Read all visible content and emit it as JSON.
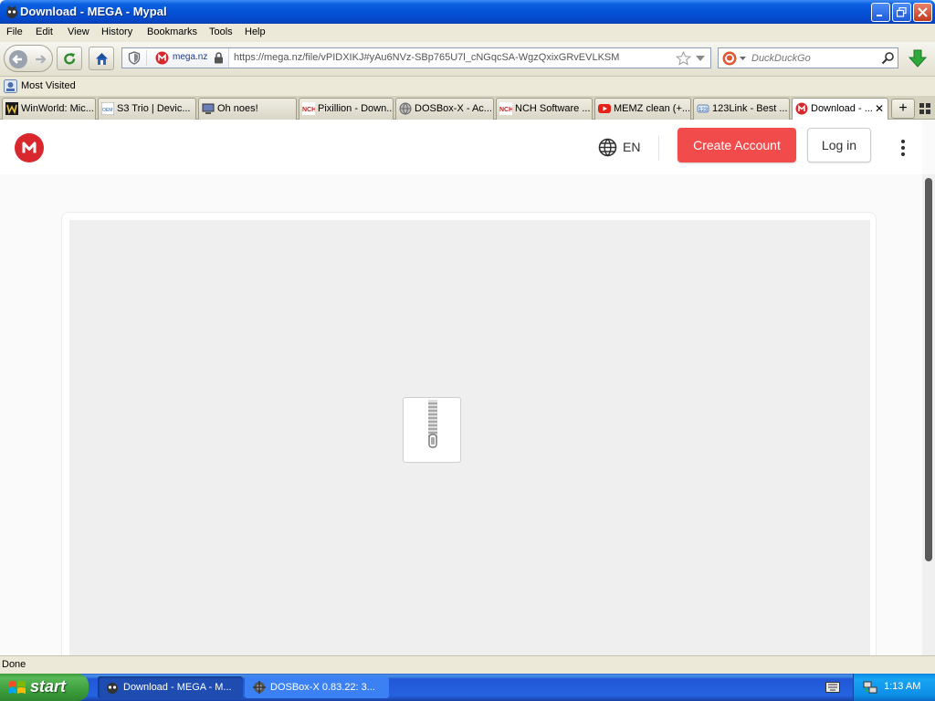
{
  "window": {
    "title": "Download - MEGA - Mypal"
  },
  "menu": {
    "items": [
      "File",
      "Edit",
      "View",
      "History",
      "Bookmarks",
      "Tools",
      "Help"
    ]
  },
  "nav": {
    "identity_domain": "mega.nz",
    "url": "https://mega.nz/file/vPIDXIKJ#yAu6NVz-SBp765U7l_cNGqcSA-WgzQxixGRvEVLKSM",
    "search_placeholder": "DuckDuckGo"
  },
  "bookmarks": {
    "most_visited": "Most Visited"
  },
  "tabs": [
    {
      "label": "WinWorld: Mic...",
      "icon": "winworld-icon"
    },
    {
      "label": "S3 Trio | Devic...",
      "icon": "oem-icon"
    },
    {
      "label": "Oh noes!",
      "icon": "computer-icon"
    },
    {
      "label": "Pixillion - Down...",
      "icon": "nch-icon"
    },
    {
      "label": "DOSBox-X - Ac...",
      "icon": "globe-icon"
    },
    {
      "label": "NCH Software ...",
      "icon": "nch-icon"
    },
    {
      "label": "MEMZ clean (+...",
      "icon": "youtube-icon"
    },
    {
      "label": "123Link - Best ...",
      "icon": "link-icon"
    },
    {
      "label": "Download - ...",
      "icon": "mega-icon"
    }
  ],
  "page": {
    "language": "EN",
    "create_account": "Create Account",
    "login": "Log in",
    "colors": {
      "brand_red": "#d9272e",
      "button_red": "#f24b4b"
    }
  },
  "status": {
    "text": "Done"
  },
  "taskbar": {
    "start": "start",
    "items": [
      "Download - MEGA - M...",
      "DOSBox-X 0.83.22: 3..."
    ],
    "clock": "1:13 AM"
  }
}
